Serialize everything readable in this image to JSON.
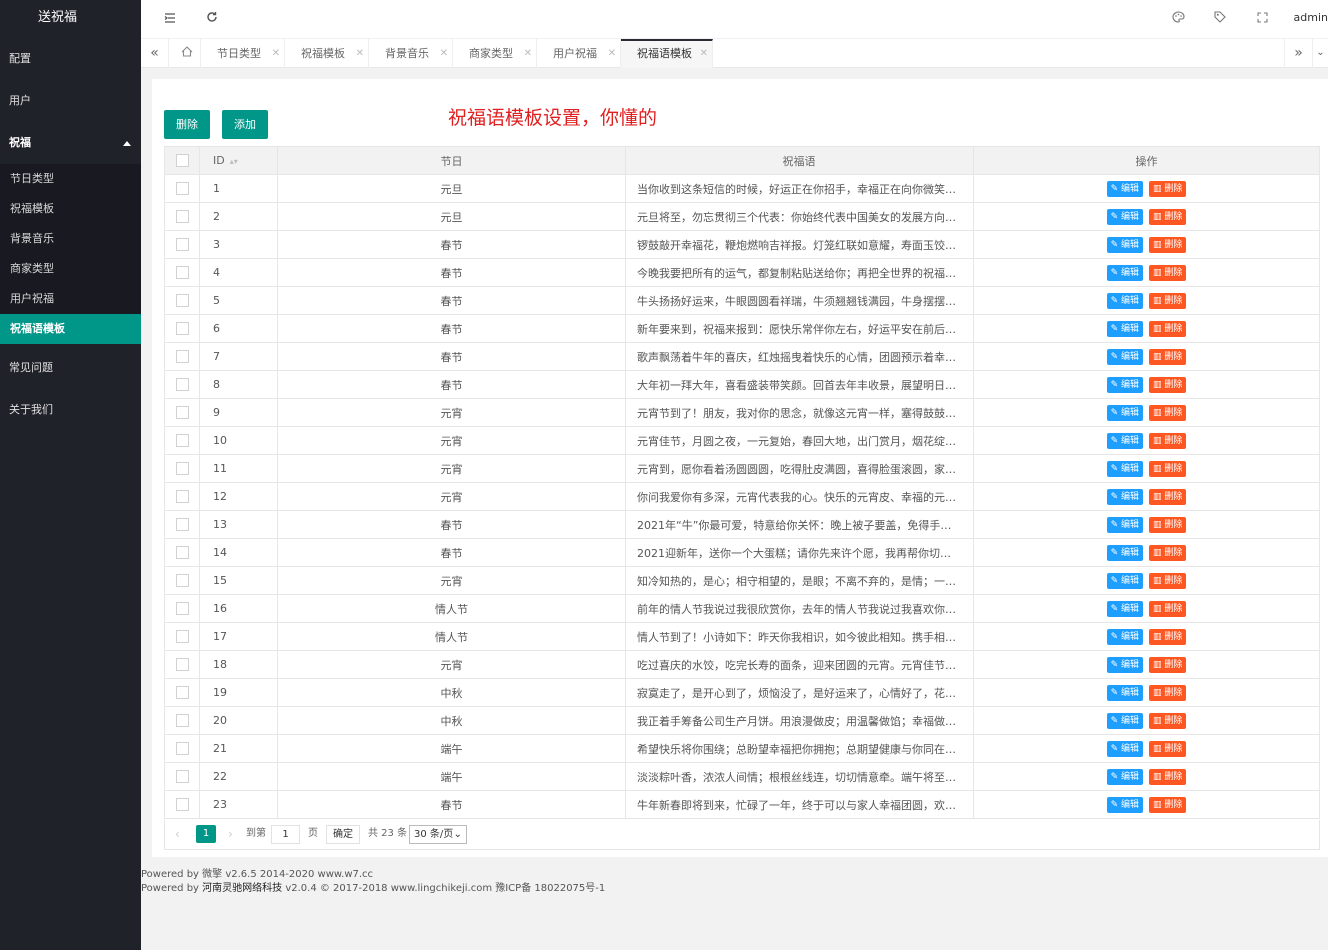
{
  "sidebar": {
    "logo": "送祝福",
    "items": [
      {
        "label": "配置"
      },
      {
        "label": "用户"
      },
      {
        "label": "祝福"
      }
    ],
    "submenu": [
      {
        "label": "节日类型"
      },
      {
        "label": "祝福模板"
      },
      {
        "label": "背景音乐"
      },
      {
        "label": "商家类型"
      },
      {
        "label": "用户祝福"
      },
      {
        "label": "祝福语模板"
      }
    ],
    "items_after": [
      {
        "label": "常见问题"
      },
      {
        "label": "关于我们"
      }
    ]
  },
  "header": {
    "user": "admin",
    "icons": [
      "menu-fold-icon",
      "refresh-icon",
      "theme-icon",
      "tag-icon",
      "fullscreen-icon"
    ]
  },
  "tabs": [
    {
      "label": "节日类型"
    },
    {
      "label": "祝福模板"
    },
    {
      "label": "背景音乐"
    },
    {
      "label": "商家类型"
    },
    {
      "label": "用户祝福"
    },
    {
      "label": "祝福语模板"
    }
  ],
  "toolbar": {
    "delete_label": "删除",
    "add_label": "添加"
  },
  "annotation": "祝福语模板设置，你懂的",
  "table": {
    "headers": {
      "id": "ID",
      "festival": "节日",
      "text": "祝福语",
      "ops": "操作"
    },
    "edit_label": "编辑",
    "delete_label": "删除",
    "rows": [
      {
        "id": "1",
        "festival": "元旦",
        "text": "当你收到这条短信的时候，好运正在你招手，幸福正在向你微笑，..."
      },
      {
        "id": "2",
        "festival": "元旦",
        "text": "元旦将至，勿忘贯彻三个代表：你始终代表中国美女的发展方向，..."
      },
      {
        "id": "3",
        "festival": "春节",
        "text": "锣鼓敲开幸福花，鞭炮燃响吉祥报。灯笼红联如意耀，寿面玉饺香..."
      },
      {
        "id": "4",
        "festival": "春节",
        "text": "今晚我要把所有的运气，都复制粘贴送给你；再把全世界的祝福语..."
      },
      {
        "id": "5",
        "festival": "春节",
        "text": "牛头扬扬好运来，牛眼圆圆看祥瑞，牛须翘翘钱满园，牛身摆摆业..."
      },
      {
        "id": "6",
        "festival": "春节",
        "text": "新年要来到，祝福来报到：愿快乐常伴你左右，好运平安在前后，..."
      },
      {
        "id": "7",
        "festival": "春节",
        "text": "歌声飘荡着牛年的喜庆，红烛摇曳着快乐的心情，团圆预示着幸福..."
      },
      {
        "id": "8",
        "festival": "春节",
        "text": "大年初一拜大年，喜看盛装带笑颜。回首去年丰收景，展望明日幸..."
      },
      {
        "id": "9",
        "festival": "元宵",
        "text": "元宵节到了！朋友，我对你的思念，就像这元宵一样，塞得鼓鼓的..."
      },
      {
        "id": "10",
        "festival": "元宵",
        "text": "元宵佳节，月圆之夜，一元复始，春回大地，出门赏月，烟花绽放..."
      },
      {
        "id": "11",
        "festival": "元宵",
        "text": "元宵到，愿你看着汤圆圆圆，吃得肚皮满圆，喜得脸蛋滚圆，家庭..."
      },
      {
        "id": "12",
        "festival": "元宵",
        "text": "你问我爱你有多深，元宵代表我的心。快乐的元宵皮、幸福的元宵..."
      },
      {
        "id": "13",
        "festival": "春节",
        "text": "2021年“牛”你最可爱，特意给你关怀：晚上被子要盖，免得手脚冷..."
      },
      {
        "id": "14",
        "festival": "春节",
        "text": "2021迎新年，送你一个大蛋糕；请你先来许个愿，我再帮你切蛋糕..."
      },
      {
        "id": "15",
        "festival": "元宵",
        "text": "知冷知热的，是心；相守相望的，是眼；不离不弃的，是情；一生..."
      },
      {
        "id": "16",
        "festival": "情人节",
        "text": "前年的情人节我说过我很欣赏你，去年的情人节我说过我喜欢你，..."
      },
      {
        "id": "17",
        "festival": "情人节",
        "text": "情人节到了！小诗如下：昨天你我相识，如今彼此相知。携手相伴..."
      },
      {
        "id": "18",
        "festival": "元宵",
        "text": "吃过喜庆的水饺，吃完长寿的面条，迎来团圆的元宵。元宵佳节马..."
      },
      {
        "id": "19",
        "festival": "中秋",
        "text": "寂寞走了，是开心到了，烦恼没了，是好运来了，心情好了，花儿..."
      },
      {
        "id": "20",
        "festival": "中秋",
        "text": "我正着手筹备公司生产月饼。用浪漫做皮；用温馨做馅；幸福做包..."
      },
      {
        "id": "21",
        "festival": "端午",
        "text": "希望快乐将你围绕；总盼望幸福把你拥抱；总期望健康与你同在；..."
      },
      {
        "id": "22",
        "festival": "端午",
        "text": "淡淡粽叶香，浓浓人间情；根根丝线连，切切情意牵。端午将至，..."
      },
      {
        "id": "23",
        "festival": "春节",
        "text": "牛年新春即将到来，忙碌了一年，终于可以与家人幸福团圆，欢乐..."
      }
    ]
  },
  "pager": {
    "current": "1",
    "goto_label": "到第",
    "page_input": "1",
    "page_unit": "页",
    "confirm_label": "确定",
    "total": "共 23 条",
    "page_size": "30 条/页"
  },
  "footer": {
    "line1": "Powered by 微擎 v2.6.5 2014-2020 www.w7.cc",
    "line2_prefix": "Powered by ",
    "line2_company": "河南灵驰网络科技",
    "line2_suffix": " v2.0.4 © 2017-2018 www.lingchikeji.com 豫ICP备 18022075号-1"
  },
  "colors": {
    "sidebar_bg": "#20222a",
    "accent": "#009688",
    "edit": "#1e9fff",
    "delete": "#ff5722",
    "annotation": "#e02020"
  }
}
